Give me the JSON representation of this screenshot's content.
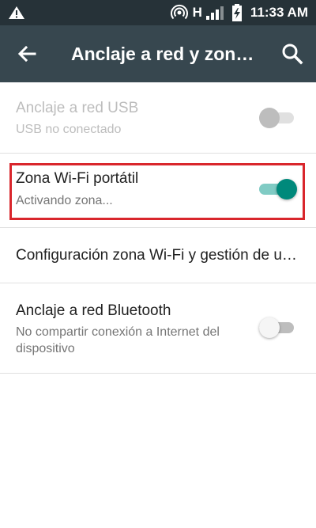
{
  "status_bar": {
    "network_type": "H",
    "time": "11:33 AM",
    "icons": [
      "warning-icon",
      "hotspot-icon",
      "signal-icon",
      "battery-charging-icon"
    ]
  },
  "app_bar": {
    "title": "Anclaje a red y zona Wi-Fi",
    "back_icon": "arrow-back-icon",
    "search_icon": "search-icon"
  },
  "settings": {
    "usb": {
      "title": "Anclaje a red USB",
      "subtitle": "USB no conectado",
      "enabled": false,
      "checked": false
    },
    "wifi_hotspot": {
      "title": "Zona Wi-Fi portátil",
      "subtitle": "Activando zona...",
      "enabled": true,
      "checked": true,
      "highlight_color": "#d9262c"
    },
    "hotspot_config": {
      "title": "Configuración zona Wi-Fi y gestión de usuarios"
    },
    "bluetooth": {
      "title": "Anclaje a red Bluetooth",
      "subtitle": "No compartir conexión a Internet del dispositivo",
      "enabled": true,
      "checked": false
    }
  },
  "colors": {
    "status_bar_bg": "#263238",
    "app_bar_bg": "#37474f",
    "accent": "#00897b",
    "accent_track": "#80cbc4"
  }
}
